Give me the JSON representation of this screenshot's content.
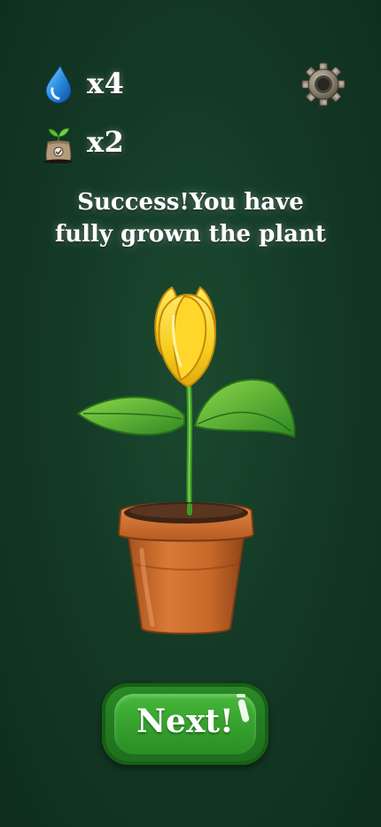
{
  "hud": {
    "water": {
      "icon": "water-drop-icon",
      "count": "x4"
    },
    "seeds": {
      "icon": "seed-bag-icon",
      "count": "x2"
    },
    "settings": {
      "icon": "gear-icon"
    }
  },
  "message": {
    "line1": "Success!You have",
    "line2": "fully grown the plant"
  },
  "plant": {
    "icon": "potted-tulip"
  },
  "next_button": {
    "label": "Next!"
  },
  "colors": {
    "background": "#143a26",
    "button_green": "#35a02d",
    "petal_yellow": "#f5cd1e",
    "leaf_green": "#3d9e2a",
    "pot_terracotta": "#c8692a"
  }
}
